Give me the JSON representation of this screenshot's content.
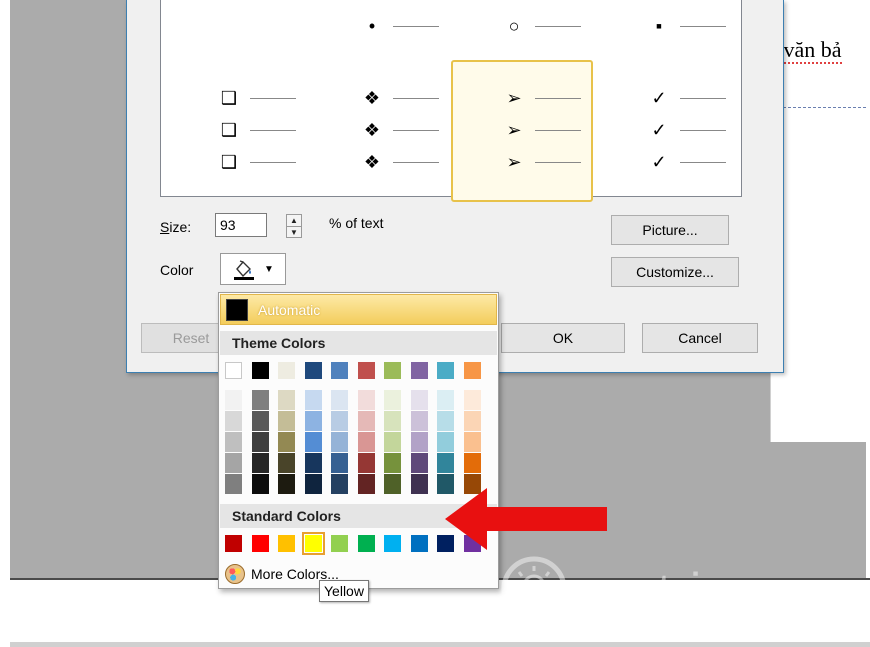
{
  "document": {
    "text": "g văn bả"
  },
  "dialog": {
    "gallery": {
      "rows": [
        [
          "",
          "•",
          "○",
          "▪"
        ],
        [
          "❑",
          "❖",
          "➢",
          "✓"
        ],
        [
          "❑",
          "❖",
          "➢",
          "✓"
        ],
        [
          "❑",
          "❖",
          "➢",
          "✓"
        ]
      ],
      "selected_column": 2
    },
    "size_label": "Size:",
    "size_value": "93",
    "size_unit": "% of text",
    "color_label": "Color",
    "buttons": {
      "picture": "Picture...",
      "customize": "Customize...",
      "reset": "Reset",
      "ok": "OK",
      "cancel": "Cancel"
    }
  },
  "color_popup": {
    "automatic_label": "Automatic",
    "theme_header": "Theme Colors",
    "standard_header": "Standard Colors",
    "more_colors": "More Colors...",
    "theme_base": [
      "#ffffff",
      "#000000",
      "#eeece1",
      "#1f497d",
      "#4f81bd",
      "#c0504d",
      "#9bbb59",
      "#8064a2",
      "#4bacc6",
      "#f79646"
    ],
    "theme_shades": [
      [
        "#f2f2f2",
        "#d8d8d8",
        "#bfbfbf",
        "#a5a5a5",
        "#7f7f7f"
      ],
      [
        "#7f7f7f",
        "#595959",
        "#3f3f3f",
        "#262626",
        "#0c0c0c"
      ],
      [
        "#ddd9c3",
        "#c4bd97",
        "#938953",
        "#494429",
        "#1d1b10"
      ],
      [
        "#c6d9f0",
        "#8db3e2",
        "#548dd4",
        "#17365d",
        "#0f243e"
      ],
      [
        "#dbe5f1",
        "#b8cce4",
        "#95b3d7",
        "#366092",
        "#244061"
      ],
      [
        "#f2dcdb",
        "#e5b9b7",
        "#d99694",
        "#953734",
        "#632423"
      ],
      [
        "#ebf1dd",
        "#d7e3bc",
        "#c3d69b",
        "#76923c",
        "#4f6128"
      ],
      [
        "#e5e0ec",
        "#ccc1d9",
        "#b2a2c7",
        "#5f497a",
        "#3f3151"
      ],
      [
        "#dbeef3",
        "#b7dde8",
        "#92cddc",
        "#31859b",
        "#205867"
      ],
      [
        "#fdeada",
        "#fbd5b5",
        "#fac08f",
        "#e36c09",
        "#974806"
      ]
    ],
    "standard": [
      "#c00000",
      "#ff0000",
      "#ffc000",
      "#ffff00",
      "#92d050",
      "#00b050",
      "#00b0f0",
      "#0070c0",
      "#002060",
      "#7030a0"
    ],
    "hovered_standard": 3
  },
  "tooltip": "Yellow",
  "watermark": {
    "text": "uantrimang"
  },
  "annotation_arrow_color": "#e81010"
}
